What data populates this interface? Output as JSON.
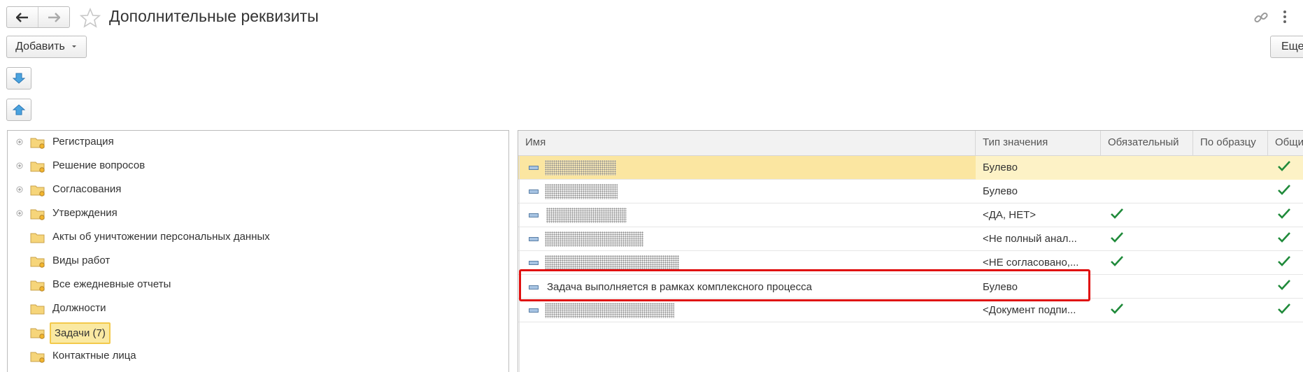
{
  "window": {
    "title": "Дополнительные реквизиты"
  },
  "toolbar": {
    "add_label": "Добавить",
    "more_label": "Еще"
  },
  "tree": {
    "items": [
      {
        "label": "Регистрация",
        "expandable": true
      },
      {
        "label": "Решение вопросов",
        "expandable": true
      },
      {
        "label": "Согласования",
        "expandable": true
      },
      {
        "label": "Утверждения",
        "expandable": true
      },
      {
        "label": "Акты об уничтожении персональных данных",
        "expandable": false
      },
      {
        "label": "Виды работ",
        "expandable": false
      },
      {
        "label": "Все ежедневные отчеты",
        "expandable": false
      },
      {
        "label": "Должности",
        "expandable": false
      },
      {
        "label": "Задачи (7)",
        "expandable": false,
        "selected": true
      },
      {
        "label": "Контактные лица",
        "expandable": false
      }
    ]
  },
  "table": {
    "columns": [
      "Имя",
      "Тип значения",
      "Обязательный",
      "По образцу",
      "Общий"
    ],
    "rows": [
      {
        "name": "",
        "name_redacted": true,
        "type": "Булево",
        "required": false,
        "by_sample": false,
        "common": true,
        "selected": true
      },
      {
        "name": "",
        "name_redacted": true,
        "type": "Булево",
        "required": false,
        "by_sample": false,
        "common": true
      },
      {
        "name": "",
        "name_redacted": true,
        "type": "<ДА, НЕТ>",
        "required": true,
        "by_sample": false,
        "common": true
      },
      {
        "name": "",
        "name_redacted": true,
        "type": "<Не полный анал...",
        "required": true,
        "by_sample": false,
        "common": true
      },
      {
        "name": "",
        "name_redacted": true,
        "type": "<НЕ согласовано,...",
        "required": true,
        "by_sample": false,
        "common": true
      },
      {
        "name": "Задача выполняется в рамках комплексного процесса",
        "name_redacted": false,
        "type": "Булево",
        "required": false,
        "by_sample": false,
        "common": true,
        "highlighted": true
      },
      {
        "name": "",
        "name_redacted": true,
        "type": "<Документ подпи...",
        "required": true,
        "by_sample": false,
        "common": true
      }
    ]
  },
  "colors": {
    "selection": "#fbe6a1",
    "check": "#1f8a3a",
    "highlight_border": "#e01010"
  }
}
